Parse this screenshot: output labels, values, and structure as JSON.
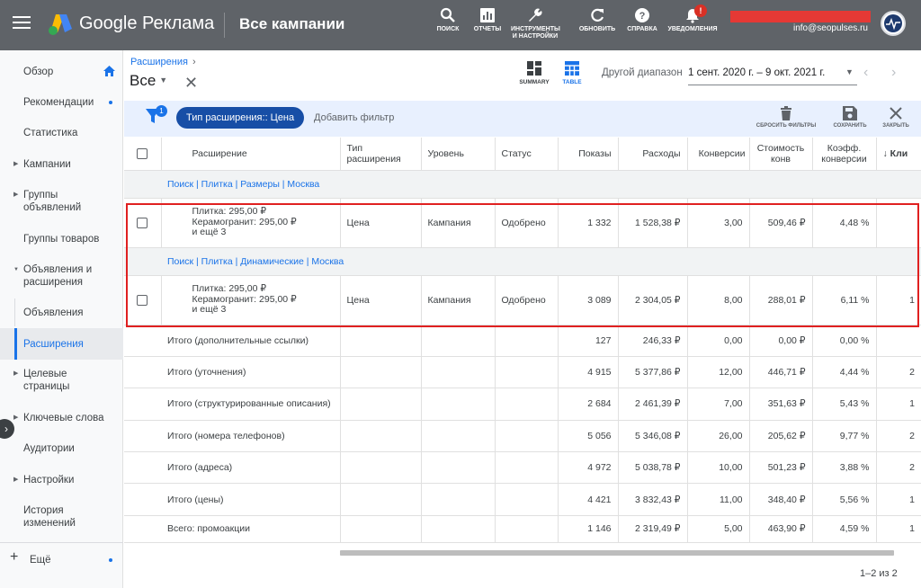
{
  "header": {
    "brand": "Google Реклама",
    "campaigns": "Все кампании",
    "tools": [
      {
        "label": "Поиск",
        "icon": "search-icon"
      },
      {
        "label": "Отчеты",
        "icon": "reports-icon"
      },
      {
        "label": "Инструменты и настройки",
        "icon": "wrench-icon"
      },
      {
        "label": "Обновить",
        "icon": "refresh-icon"
      },
      {
        "label": "Справка",
        "icon": "help-icon"
      },
      {
        "label": "Уведомления",
        "icon": "bell-icon"
      }
    ],
    "notification_count": "!",
    "email": "info@seopulses.ru"
  },
  "sidebar": {
    "items": [
      {
        "label": "Обзор"
      },
      {
        "label": "Рекомендации"
      },
      {
        "label": "Статистика"
      },
      {
        "label": "Кампании"
      },
      {
        "label": "Группы объявлений"
      },
      {
        "label": "Группы товаров"
      },
      {
        "label": "Объявления и расширения"
      },
      {
        "label": "Объявления"
      },
      {
        "label": "Расширения"
      },
      {
        "label": "Целевые страницы"
      },
      {
        "label": "Ключевые слова"
      },
      {
        "label": "Аудитории"
      },
      {
        "label": "Настройки"
      },
      {
        "label": "История изменений"
      },
      {
        "label": "Ещё"
      }
    ]
  },
  "toolbar": {
    "breadcrumb": "Расширения",
    "scope": "Все",
    "view_summary": "SUMMARY",
    "view_table": "TABLE",
    "range_label": "Другой диапазон",
    "range_value": "1 сент. 2020 г. – 9 окт. 2021 г."
  },
  "filters": {
    "count": "1",
    "chip": "Тип расширения:: Цена",
    "add": "Добавить фильтр",
    "reset": "СБРОСИТЬ ФИЛЬТРЫ",
    "save": "СОХРАНИТЬ",
    "close": "ЗАКРЫТЬ"
  },
  "table": {
    "headers": {
      "ext": "Расширение",
      "type": "Тип расширения",
      "level": "Уровень",
      "status": "Статус",
      "impr": "Показы",
      "cost": "Расходы",
      "conv": "Конверсии",
      "cpa": "Стоимость конв",
      "cr": "Коэфф. конверсии",
      "clicks": "Кли"
    },
    "groups": [
      {
        "title": "Поиск | Плитка | Размеры | Москва",
        "row": {
          "l1": "Плитка: 295,00 ₽",
          "l2": "Керамогранит: 295,00 ₽",
          "l3": "и ещё 3",
          "type": "Цена",
          "level": "Кампания",
          "status": "Одобрено",
          "impr": "1 332",
          "cost": "1 528,38 ₽",
          "conv": "3,00",
          "cpa": "509,46 ₽",
          "cr": "4,48 %",
          "clicks": ""
        }
      },
      {
        "title": "Поиск | Плитка | Динамические | Москва",
        "row": {
          "l1": "Плитка: 295,00 ₽",
          "l2": "Керамогранит: 295,00 ₽",
          "l3": "и ещё 3",
          "type": "Цена",
          "level": "Кампания",
          "status": "Одобрено",
          "impr": "3 089",
          "cost": "2 304,05 ₽",
          "conv": "8,00",
          "cpa": "288,01 ₽",
          "cr": "6,11 %",
          "clicks": "1"
        }
      }
    ],
    "totals": [
      {
        "label": "Итого (дополнительные ссылки)",
        "impr": "127",
        "cost": "246,33 ₽",
        "conv": "0,00",
        "cpa": "0,00 ₽",
        "cr": "0,00 %",
        "clicks": ""
      },
      {
        "label": "Итого (уточнения)",
        "impr": "4 915",
        "cost": "5 377,86 ₽",
        "conv": "12,00",
        "cpa": "446,71 ₽",
        "cr": "4,44 %",
        "clicks": "2"
      },
      {
        "label": "Итого (структурированные описания)",
        "impr": "2 684",
        "cost": "2 461,39 ₽",
        "conv": "7,00",
        "cpa": "351,63 ₽",
        "cr": "5,43 %",
        "clicks": "1"
      },
      {
        "label": "Итого (номера телефонов)",
        "impr": "5 056",
        "cost": "5 346,08 ₽",
        "conv": "26,00",
        "cpa": "205,62 ₽",
        "cr": "9,77 %",
        "clicks": "2"
      },
      {
        "label": "Итого (адреса)",
        "impr": "4 972",
        "cost": "5 038,78 ₽",
        "conv": "10,00",
        "cpa": "501,23 ₽",
        "cr": "3,88 %",
        "clicks": "2"
      },
      {
        "label": "Итого (цены)",
        "impr": "4 421",
        "cost": "3 832,43 ₽",
        "conv": "11,00",
        "cpa": "348,40 ₽",
        "cr": "5,56 %",
        "clicks": "1"
      },
      {
        "label": "Всего: промоакции",
        "impr": "1 146",
        "cost": "2 319,49 ₽",
        "conv": "5,00",
        "cpa": "463,90 ₽",
        "cr": "4,59 %",
        "clicks": "1"
      }
    ]
  },
  "pager": "1–2 из 2",
  "colors": {
    "header_bg": "#5f6368",
    "accent": "#1a73e8",
    "chip": "#174ea6",
    "highlight": "#e02020"
  }
}
